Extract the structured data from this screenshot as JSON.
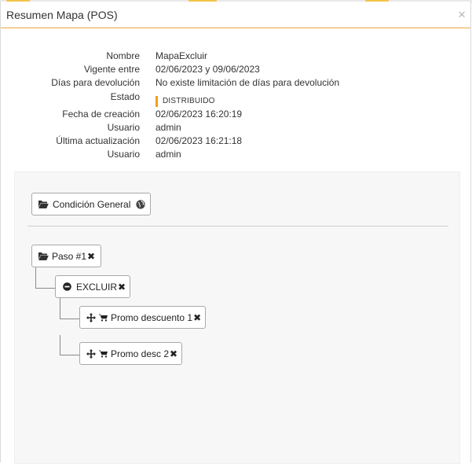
{
  "modal": {
    "title": "Resumen Mapa (POS)",
    "close_glyph": "×"
  },
  "info": {
    "nombre": {
      "label": "Nombre",
      "value": "MapaExcluir"
    },
    "vigente": {
      "label": "Vigente entre",
      "value": "02/06/2023 y 09/06/2023"
    },
    "dias": {
      "label": "Días para devolución",
      "value": "No existe limitación de días para devolución"
    },
    "estado": {
      "label": "Estado",
      "value": "DISTRIBUIDO",
      "color": "#f0a020"
    },
    "creacion": {
      "label": "Fecha de creación",
      "value": "02/06/2023 16:20:19"
    },
    "usuario1": {
      "label": "Usuario",
      "value": "admin"
    },
    "actualizacion": {
      "label": "Última actualización",
      "value": "02/06/2023 16:21:18"
    },
    "usuario2": {
      "label": "Usuario",
      "value": "admin"
    }
  },
  "tree": {
    "condicion": {
      "label": "Condición General",
      "icon": "folder-open-icon",
      "trailing_icon": "globe-icon"
    },
    "paso": {
      "label": "Paso #1",
      "icon": "folder-open-icon",
      "remove": "✖"
    },
    "excluir": {
      "label": "EXCLUIR",
      "icon": "minus-circle-icon",
      "remove": "✖"
    },
    "promo1": {
      "label": "Promo descuento 1",
      "icons": [
        "move-icon",
        "cart-icon"
      ],
      "remove": "✖"
    },
    "promo2": {
      "label": "Promo desc 2",
      "icons": [
        "move-icon",
        "cart-icon"
      ],
      "remove": "✖"
    }
  },
  "colors": {
    "accent": "#f0a83a",
    "panel_bg": "#f7f7f7"
  }
}
